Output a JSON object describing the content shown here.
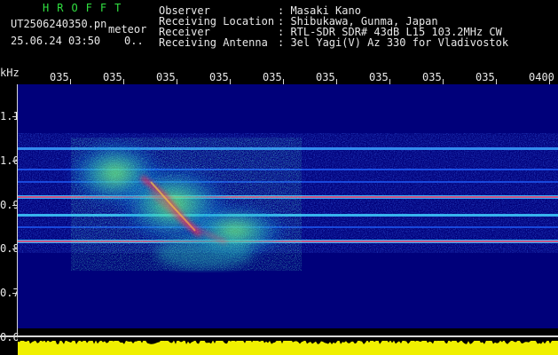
{
  "program": "HROFFT",
  "file": {
    "filename": "UT2506240350.pn",
    "label": "meteor",
    "datetime": "25.06.24 03:50",
    "counter": "0.."
  },
  "info": [
    {
      "label": "Observer",
      "value": ": Masaki Kano"
    },
    {
      "label": "Receiving Location",
      "value": ": Shibukawa, Gunma, Japan"
    },
    {
      "label": "Receiver",
      "value": ": RTL-SDR SDR# 43dB L15 103.2MHz CW"
    },
    {
      "label": "Receiving Antenna",
      "value": ": 3el Yagi(V) Az 330 for Vladivostok"
    }
  ],
  "y_axis": {
    "unit": "kHz",
    "ticks": [
      "1.1",
      "1.0",
      "0.9",
      "0.8",
      "0.7",
      "0.6"
    ]
  },
  "x_axis": {
    "ticks": [
      "035",
      "035",
      "035",
      "035",
      "035",
      "035",
      "035",
      "035",
      "035",
      "0400"
    ]
  },
  "colors": {
    "background": "#000000",
    "spectrogram_bg": "#00007a",
    "text": "#e8e8e8",
    "title": "#30e040",
    "amplitude": "#f0f000",
    "echo_hot": "#ff3060"
  }
}
